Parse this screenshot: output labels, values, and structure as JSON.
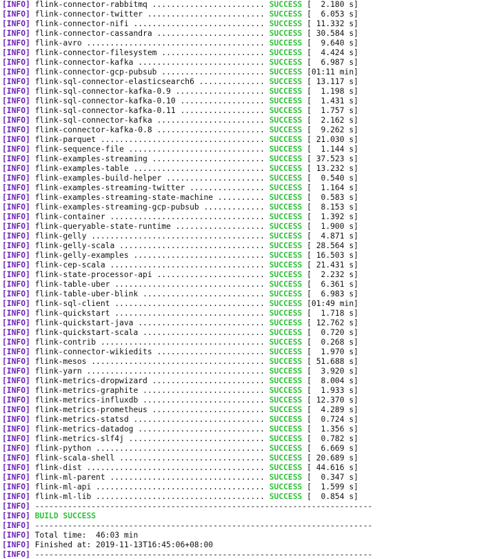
{
  "terminal": {
    "info_tag": "[INFO]",
    "modules": [
      {
        "name": "flink-connector-rabbitmq",
        "status": "SUCCESS",
        "time": "  2.180 s]"
      },
      {
        "name": "flink-connector-twitter",
        "status": "SUCCESS",
        "time": "  6.053 s]"
      },
      {
        "name": "flink-connector-nifi",
        "status": "SUCCESS",
        "time": " 11.332 s]"
      },
      {
        "name": "flink-connector-cassandra",
        "status": "SUCCESS",
        "time": " 30.584 s]"
      },
      {
        "name": "flink-avro",
        "status": "SUCCESS",
        "time": "  9.640 s]"
      },
      {
        "name": "flink-connector-filesystem",
        "status": "SUCCESS",
        "time": "  4.424 s]"
      },
      {
        "name": "flink-connector-kafka",
        "status": "SUCCESS",
        "time": "  6.987 s]"
      },
      {
        "name": "flink-connector-gcp-pubsub",
        "status": "SUCCESS",
        "time": "01:11 min]"
      },
      {
        "name": "flink-sql-connector-elasticsearch6",
        "status": "SUCCESS",
        "time": " 13.117 s]"
      },
      {
        "name": "flink-sql-connector-kafka-0.9",
        "status": "SUCCESS",
        "time": "  1.198 s]"
      },
      {
        "name": "flink-sql-connector-kafka-0.10",
        "status": "SUCCESS",
        "time": "  1.431 s]"
      },
      {
        "name": "flink-sql-connector-kafka-0.11",
        "status": "SUCCESS",
        "time": "  1.757 s]"
      },
      {
        "name": "flink-sql-connector-kafka",
        "status": "SUCCESS",
        "time": "  2.162 s]"
      },
      {
        "name": "flink-connector-kafka-0.8",
        "status": "SUCCESS",
        "time": "  9.262 s]"
      },
      {
        "name": "flink-parquet",
        "status": "SUCCESS",
        "time": " 21.030 s]"
      },
      {
        "name": "flink-sequence-file",
        "status": "SUCCESS",
        "time": "  1.144 s]"
      },
      {
        "name": "flink-examples-streaming",
        "status": "SUCCESS",
        "time": " 37.523 s]"
      },
      {
        "name": "flink-examples-table",
        "status": "SUCCESS",
        "time": " 13.232 s]"
      },
      {
        "name": "flink-examples-build-helper",
        "status": "SUCCESS",
        "time": "  0.540 s]"
      },
      {
        "name": "flink-examples-streaming-twitter",
        "status": "SUCCESS",
        "time": "  1.164 s]"
      },
      {
        "name": "flink-examples-streaming-state-machine",
        "status": "SUCCESS",
        "time": "  0.583 s]"
      },
      {
        "name": "flink-examples-streaming-gcp-pubsub",
        "status": "SUCCESS",
        "time": "  8.153 s]"
      },
      {
        "name": "flink-container",
        "status": "SUCCESS",
        "time": "  1.392 s]"
      },
      {
        "name": "flink-queryable-state-runtime",
        "status": "SUCCESS",
        "time": "  1.900 s]"
      },
      {
        "name": "flink-gelly",
        "status": "SUCCESS",
        "time": "  4.871 s]"
      },
      {
        "name": "flink-gelly-scala",
        "status": "SUCCESS",
        "time": " 28.564 s]"
      },
      {
        "name": "flink-gelly-examples",
        "status": "SUCCESS",
        "time": " 16.503 s]"
      },
      {
        "name": "flink-cep-scala",
        "status": "SUCCESS",
        "time": " 21.431 s]"
      },
      {
        "name": "flink-state-processor-api",
        "status": "SUCCESS",
        "time": "  2.232 s]"
      },
      {
        "name": "flink-table-uber",
        "status": "SUCCESS",
        "time": "  6.361 s]"
      },
      {
        "name": "flink-table-uber-blink",
        "status": "SUCCESS",
        "time": "  6.983 s]"
      },
      {
        "name": "flink-sql-client",
        "status": "SUCCESS",
        "time": "01:49 min]"
      },
      {
        "name": "flink-quickstart",
        "status": "SUCCESS",
        "time": "  1.718 s]"
      },
      {
        "name": "flink-quickstart-java",
        "status": "SUCCESS",
        "time": " 12.762 s]"
      },
      {
        "name": "flink-quickstart-scala",
        "status": "SUCCESS",
        "time": "  0.720 s]"
      },
      {
        "name": "flink-contrib",
        "status": "SUCCESS",
        "time": "  0.268 s]"
      },
      {
        "name": "flink-connector-wikiedits",
        "status": "SUCCESS",
        "time": "  1.970 s]"
      },
      {
        "name": "flink-mesos",
        "status": "SUCCESS",
        "time": " 51.688 s]"
      },
      {
        "name": "flink-yarn",
        "status": "SUCCESS",
        "time": "  3.920 s]"
      },
      {
        "name": "flink-metrics-dropwizard",
        "status": "SUCCESS",
        "time": "  8.004 s]"
      },
      {
        "name": "flink-metrics-graphite",
        "status": "SUCCESS",
        "time": "  1.933 s]"
      },
      {
        "name": "flink-metrics-influxdb",
        "status": "SUCCESS",
        "time": " 12.370 s]"
      },
      {
        "name": "flink-metrics-prometheus",
        "status": "SUCCESS",
        "time": "  4.289 s]"
      },
      {
        "name": "flink-metrics-statsd",
        "status": "SUCCESS",
        "time": "  0.724 s]"
      },
      {
        "name": "flink-metrics-datadog",
        "status": "SUCCESS",
        "time": "  1.356 s]"
      },
      {
        "name": "flink-metrics-slf4j",
        "status": "SUCCESS",
        "time": "  0.782 s]"
      },
      {
        "name": "flink-python",
        "status": "SUCCESS",
        "time": "  6.669 s]"
      },
      {
        "name": "flink-scala-shell",
        "status": "SUCCESS",
        "time": " 20.689 s]"
      },
      {
        "name": "flink-dist",
        "status": "SUCCESS",
        "time": " 44.616 s]"
      },
      {
        "name": "flink-ml-parent",
        "status": "SUCCESS",
        "time": "  0.347 s]"
      },
      {
        "name": "flink-ml-api",
        "status": "SUCCESS",
        "time": "  1.599 s]"
      },
      {
        "name": "flink-ml-lib",
        "status": "SUCCESS",
        "time": "  0.854 s]"
      }
    ],
    "separator": "------------------------------------------------------------------------",
    "build_result": "BUILD SUCCESS",
    "total_time": "Total time:  46:03 min",
    "finished_at": "Finished at: 2019-11-13T16:45:06+08:00"
  },
  "colors": {
    "info_tag": "#6a1fb5",
    "success": "#2fc23a",
    "text": "#111111",
    "background": "#ffffff"
  }
}
